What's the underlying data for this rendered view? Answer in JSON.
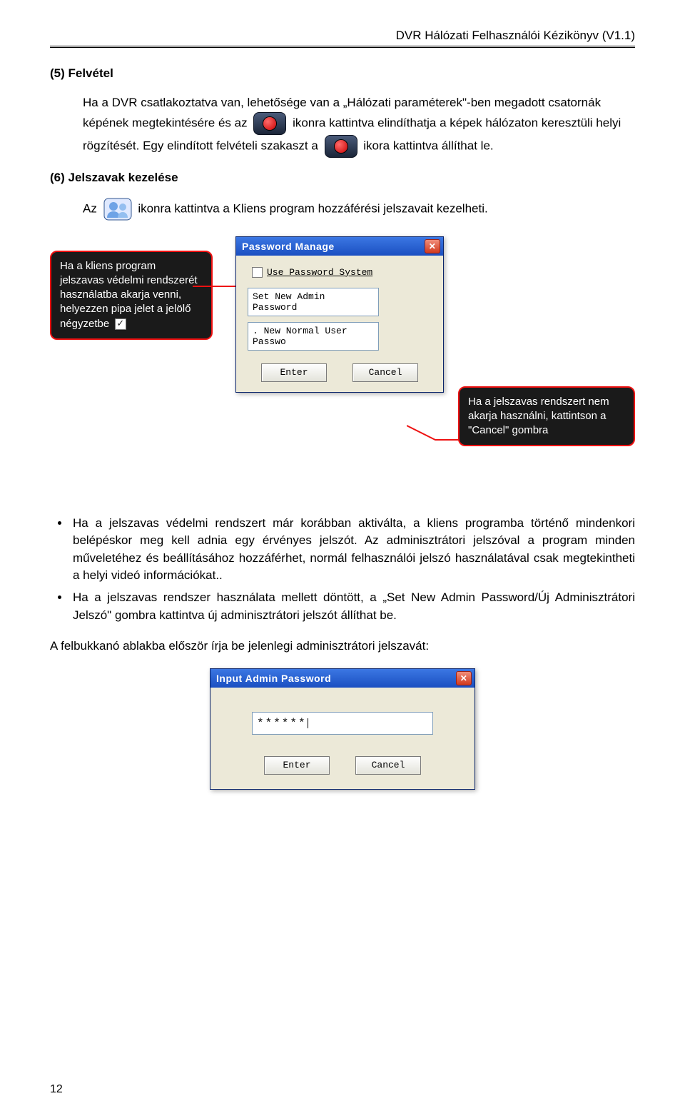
{
  "header": {
    "title": "DVR Hálózati Felhasználói Kézikönyv (V1.1)"
  },
  "section5": {
    "heading": "(5) Felvétel",
    "p1a": "Ha a DVR csatlakoztatva van, lehetősége van a „Hálózati paraméterek\"-ben megadott csatornák képének megtekintésére és az",
    "p1b": "ikonra kattintva elindíthatja a képek hálózaton keresztüli helyi rögzítését. Egy elindított felvételi szakaszt a",
    "p1c": "ikora kattintva állíthat le."
  },
  "section6": {
    "heading": "(6) Jelszavak kezelése",
    "p2a": "Az",
    "p2b": "ikonra kattintva a Kliens program hozzáférési jelszavait kezelheti."
  },
  "callouts": {
    "left": "Ha a kliens program jelszavas védelmi rendszerét használatba akarja venni, helyezzen pipa jelet a jelölő négyzetbe",
    "right": "Ha a jelszavas rendszert nem akarja használni, kattintson a \"Cancel\" gombra"
  },
  "dialog1": {
    "title": "Password Manage",
    "chk_label": "Use Password System",
    "btn_setadmin": "Set New Admin Password",
    "btn_newuser": ". New Normal User Passwo",
    "enter": "Enter",
    "cancel": "Cancel"
  },
  "bullets": {
    "b1": "Ha a jelszavas védelmi rendszert már korábban aktiválta, a kliens programba történő mindenkori belépéskor meg kell adnia egy érvényes jelszót. Az adminisztrátori jelszóval a program minden műveletéhez és beállításához hozzáférhet, normál felhasználói jelszó használatával csak megtekintheti a helyi videó információkat..",
    "b2": "Ha a jelszavas rendszer használata mellett döntött, a „Set New Admin Password/Új Adminisztrátori Jelszó\" gombra kattintva új adminisztrátori jelszót állíthat be."
  },
  "p3": "A felbukkanó ablakba először írja be jelenlegi adminisztrátori jelszavát:",
  "dialog2": {
    "title": "Input Admin Password",
    "value": "******",
    "enter": "Enter",
    "cancel": "Cancel"
  },
  "page_number": "12"
}
